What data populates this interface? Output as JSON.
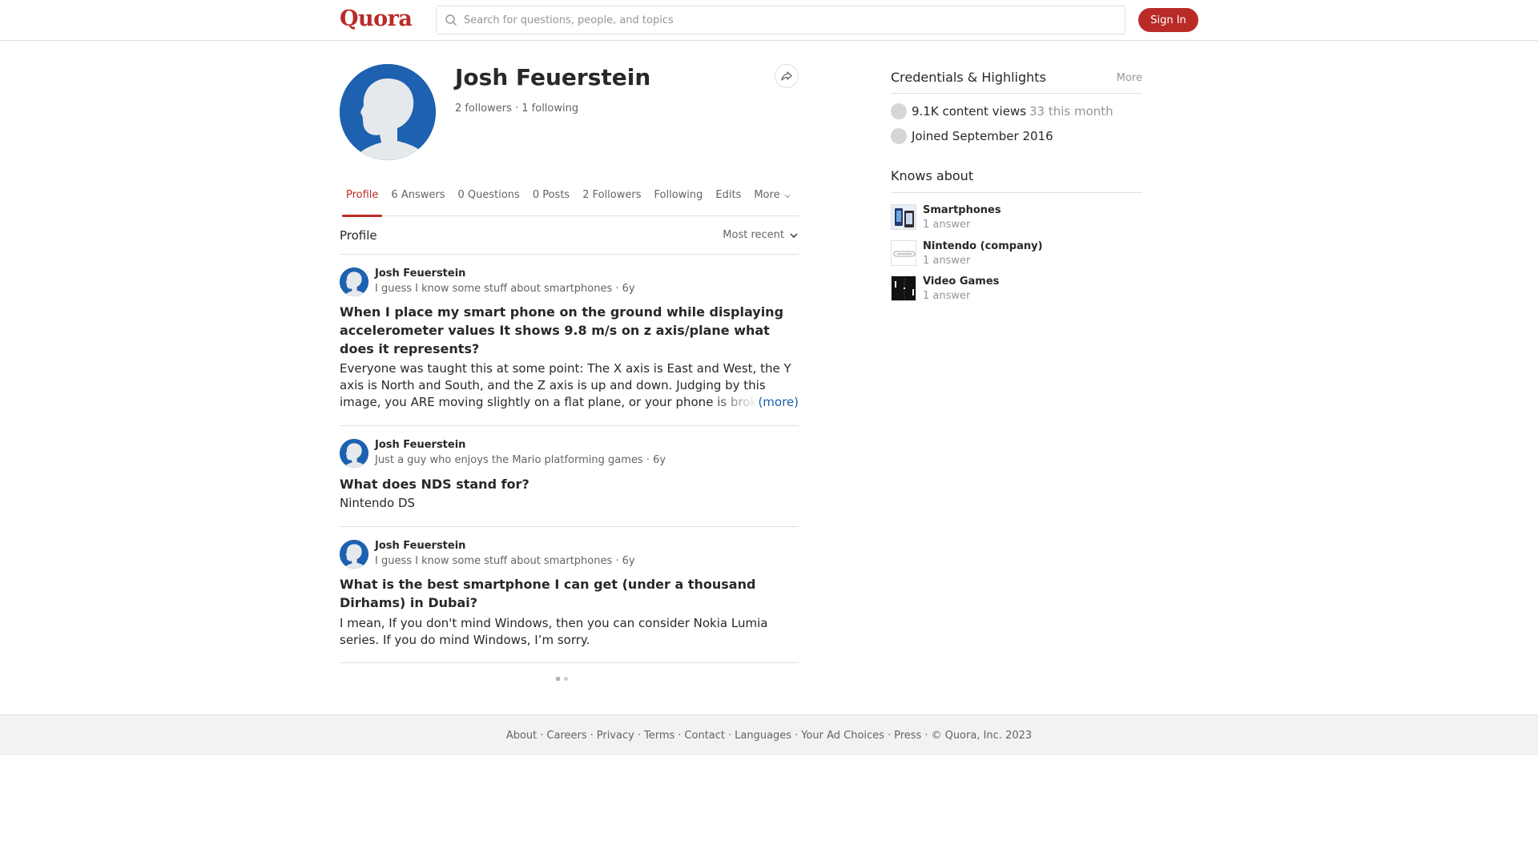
{
  "header": {
    "logo": "Quora",
    "search_placeholder": "Search for questions, people, and topics",
    "signin_label": "Sign In"
  },
  "profile": {
    "name": "Josh Feuerstein",
    "followers": "2 followers",
    "following": "1 following"
  },
  "tabs": [
    "Profile",
    "6 Answers",
    "0 Questions",
    "0 Posts",
    "2 Followers",
    "Following",
    "Edits",
    "More"
  ],
  "section": {
    "title": "Profile",
    "sort": "Most recent"
  },
  "posts": [
    {
      "author": "Josh Feuerstein",
      "credential": "I guess I know some stuff about smartphones",
      "age": "6y",
      "question": "When I place my smart phone on the ground while displaying accelerometer values It shows 9.8 m/s on z axis/plane what does it represents?",
      "answer": "Everyone was taught this at some point: The X axis is East and West, the Y axis is North and South, and the Z axis is up and down. Judging by this image, you ARE moving slightly on a flat plane, or your phone is brok",
      "more": "(more)"
    },
    {
      "author": "Josh Feuerstein",
      "credential": "Just a guy who enjoys the Mario platforming games",
      "age": "6y",
      "question": "What does NDS stand for?",
      "answer": "Nintendo DS"
    },
    {
      "author": "Josh Feuerstein",
      "credential": "I guess I know some stuff about smartphones",
      "age": "6y",
      "question": "What is the best smartphone I can get (under a thousand Dirhams) in Dubai?",
      "answer": "I mean, If you don't mind Windows, then you can consider Nokia Lumia series. If you do mind Windows, I’m sorry."
    }
  ],
  "sidebar": {
    "credentials_title": "Credentials & Highlights",
    "more": "More",
    "views": "9.1K content views",
    "views_month": "33 this month",
    "joined": "Joined September 2016",
    "knows_title": "Knows about",
    "topics": [
      {
        "name": "Smartphones",
        "count": "1 answer"
      },
      {
        "name": "Nintendo (company)",
        "count": "1 answer"
      },
      {
        "name": "Video Games",
        "count": "1 answer"
      }
    ]
  },
  "footer": {
    "links": [
      "About",
      "Careers",
      "Privacy",
      "Terms",
      "Contact",
      "Languages",
      "Your Ad Choices",
      "Press"
    ],
    "copyright": "© Quora, Inc. 2023"
  },
  "colors": {
    "brand": "#b92b27",
    "link": "#195faa",
    "avatar": "#1d61b0"
  }
}
